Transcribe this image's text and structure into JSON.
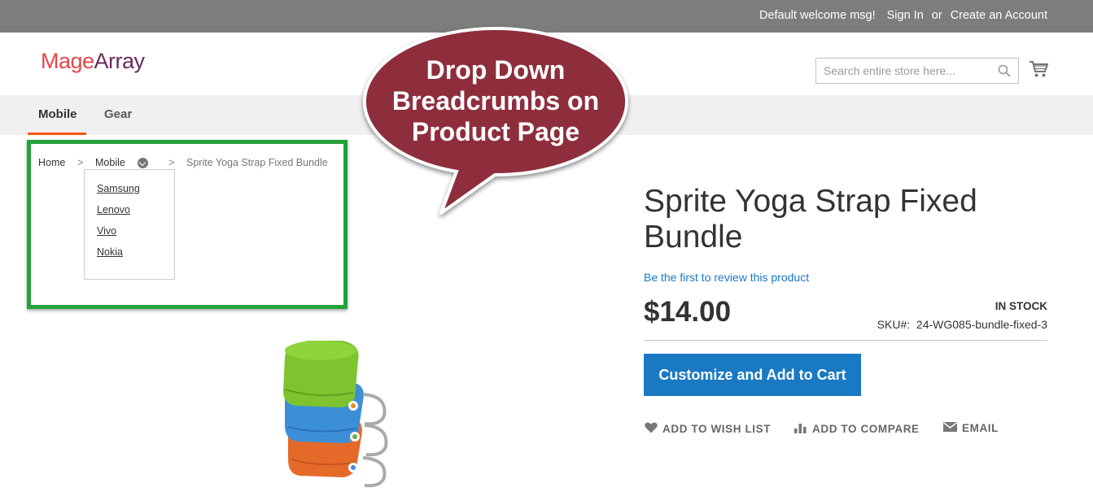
{
  "header": {
    "welcome": "Default welcome msg!",
    "sign_in": "Sign In",
    "or": "or",
    "create_account": "Create an Account",
    "logo_part1": "Mage",
    "logo_part2": "Array",
    "search_placeholder": "Search entire store here..."
  },
  "nav": {
    "items": [
      {
        "label": "Mobile",
        "active": true
      },
      {
        "label": "Gear",
        "active": false
      }
    ]
  },
  "breadcrumbs": {
    "items": [
      "Home",
      "Mobile",
      "Sprite Yoga Strap Fixed Bundle"
    ],
    "separator": ">",
    "dropdown": [
      "Samsung",
      "Lenovo",
      "Vivo",
      "Nokia"
    ]
  },
  "callout": {
    "line1": "Drop Down",
    "line2": "Breadcrumbs on",
    "line3": "Product Page"
  },
  "product": {
    "title": "Sprite Yoga Strap Fixed Bundle",
    "review_link": "Be the first to review this product",
    "price": "$14.00",
    "stock": "IN STOCK",
    "sku_label": "SKU#:",
    "sku_value": "24-WG085-bundle-fixed-3",
    "cart_button": "Customize and Add to Cart",
    "actions": {
      "wishlist": "ADD TO WISH LIST",
      "compare": "ADD TO COMPARE",
      "email": "EMAIL"
    }
  },
  "colors": {
    "topbar": "#7b7e7b",
    "accent": "#ff5501",
    "link": "#1979c3",
    "frame": "#23a23a",
    "bubble": "#8e2d3d"
  }
}
